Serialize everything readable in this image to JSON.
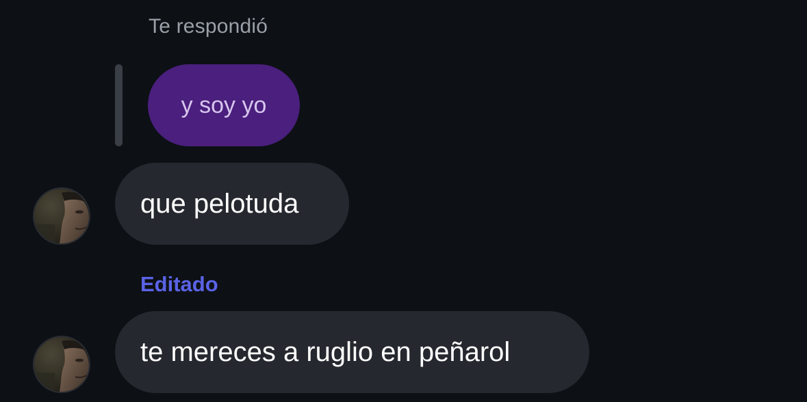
{
  "reply_header": "Te respondió",
  "quoted_message": "y soy yo",
  "messages": [
    {
      "text": "que pelotuda",
      "edited": false
    },
    {
      "text": "te mereces a ruglio en peñarol",
      "edited": true
    }
  ],
  "edited_label": "Editado",
  "colors": {
    "background": "#0d1015",
    "bubble": "#25282e",
    "quoted_bubble": "#4a1f7d",
    "edited_accent": "#5a63e6",
    "muted_text": "#9aa0a8"
  }
}
